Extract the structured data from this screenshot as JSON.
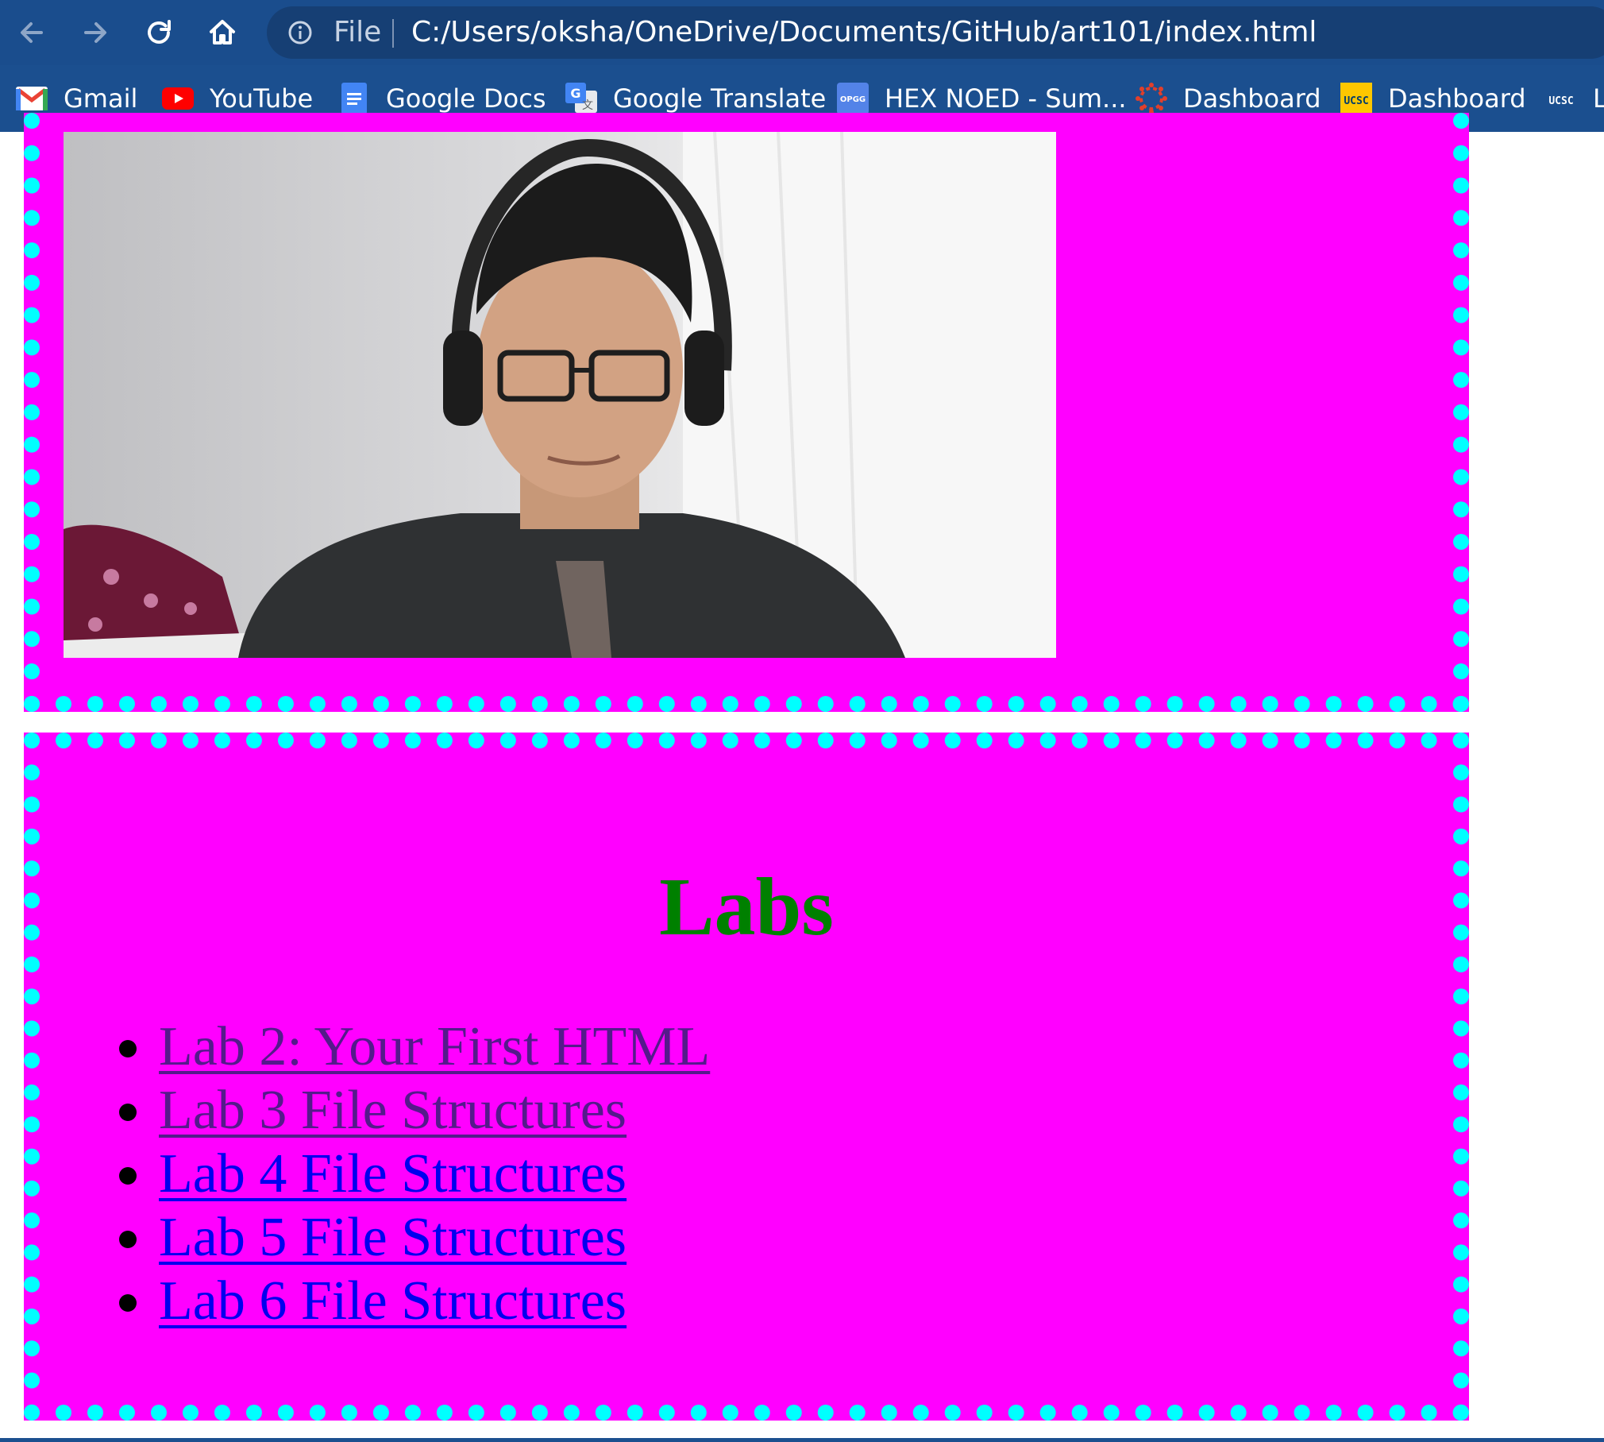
{
  "browser": {
    "nav": {
      "back_icon": "arrow-left-icon",
      "forward_icon": "arrow-right-icon",
      "reload_icon": "reload-icon",
      "home_icon": "home-icon"
    },
    "omnibox": {
      "scheme_label": "File",
      "url": "C:/Users/oksha/OneDrive/Documents/GitHub/art101/index.html"
    },
    "bookmarks": [
      {
        "label": "Gmail",
        "icon": "gmail-icon"
      },
      {
        "label": "YouTube",
        "icon": "youtube-icon"
      },
      {
        "label": "Google Docs",
        "icon": "google-docs-icon"
      },
      {
        "label": "Google Translate",
        "icon": "google-translate-icon"
      },
      {
        "label": "HEX NOED - Sum...",
        "icon": "opgg-icon",
        "icon_text": "OPGG"
      },
      {
        "label": "Dashboard",
        "icon": "canvas-icon"
      },
      {
        "label": "Dashboard",
        "icon": "ucsc-icon",
        "icon_text": "UCSC"
      },
      {
        "label": "L",
        "icon": "ucsc-icon",
        "icon_text": "UCSC"
      }
    ],
    "colors": {
      "chrome": "#1b4f8f",
      "omnibox": "#163f74"
    }
  },
  "page": {
    "colors": {
      "box_background": "#ff00ff",
      "box_border": "#00ffff",
      "heading": "#008000",
      "visited_link": "#551a8b",
      "link": "#0000ee"
    },
    "photo_alt": "profile-photo",
    "labs": {
      "title": "Labs",
      "items": [
        {
          "label": "Lab 2: Your First HTML",
          "visited": true
        },
        {
          "label": "Lab 3 File Structures",
          "visited": true
        },
        {
          "label": "Lab 4 File Structures",
          "visited": false
        },
        {
          "label": "Lab 5 File Structures",
          "visited": false
        },
        {
          "label": "Lab 6 File Structures",
          "visited": false
        }
      ]
    }
  }
}
